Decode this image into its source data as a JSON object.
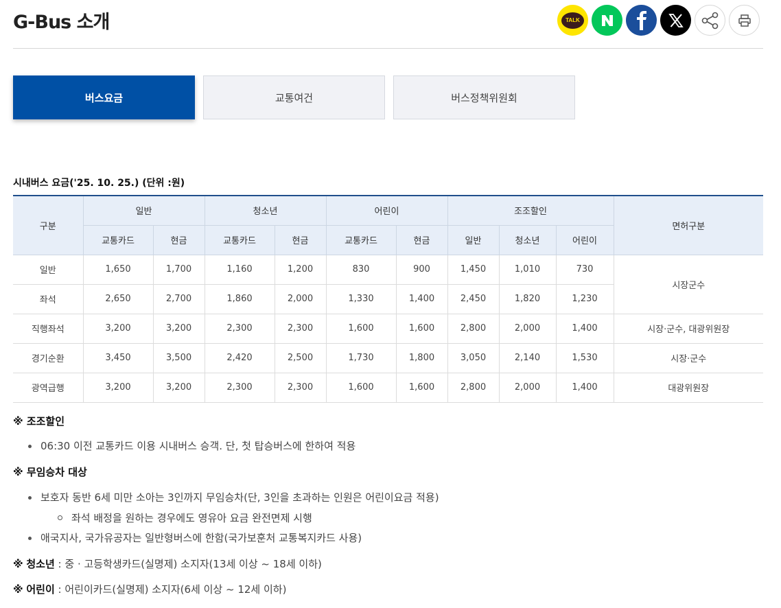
{
  "page": {
    "title": "G-Bus 소개"
  },
  "share": {
    "kakao_label": "TALK",
    "naver_icon": "naver-n-icon",
    "facebook_icon": "facebook-f-icon",
    "x_icon": "x-logo-icon",
    "share_icon": "share-nodes-icon",
    "print_icon": "printer-icon"
  },
  "tabs": [
    {
      "label": "버스요금",
      "active": true
    },
    {
      "label": "교통여건",
      "active": false
    },
    {
      "label": "버스정책위원회",
      "active": false
    }
  ],
  "table": {
    "caption": "시내버스 요금('25. 10. 25.) (단위 :원)",
    "head": {
      "category": "구분",
      "groups": [
        "일반",
        "청소년",
        "어린이",
        "조조할인"
      ],
      "license": "면허구분",
      "sub": [
        "교통카드",
        "현금",
        "교통카드",
        "현금",
        "교통카드",
        "현금",
        "일반",
        "청소년",
        "어린이"
      ]
    },
    "rows": [
      {
        "name": "일반",
        "values": [
          "1,650",
          "1,700",
          "1,160",
          "1,200",
          "830",
          "900",
          "1,450",
          "1,010",
          "730"
        ]
      },
      {
        "name": "좌석",
        "values": [
          "2,650",
          "2,700",
          "1,860",
          "2,000",
          "1,330",
          "1,400",
          "2,450",
          "1,820",
          "1,230"
        ]
      },
      {
        "name": "직행좌석",
        "values": [
          "3,200",
          "3,200",
          "2,300",
          "2,300",
          "1,600",
          "1,600",
          "2,800",
          "2,000",
          "1,400"
        ]
      },
      {
        "name": "경기순환",
        "values": [
          "3,450",
          "3,500",
          "2,420",
          "2,500",
          "1,730",
          "1,800",
          "3,050",
          "2,140",
          "1,530"
        ]
      },
      {
        "name": "광역급행",
        "values": [
          "3,200",
          "3,200",
          "2,300",
          "2,300",
          "1,600",
          "1,600",
          "2,800",
          "2,000",
          "1,400"
        ]
      }
    ],
    "license": [
      "시장군수",
      "시장·군수, 대광위원장",
      "시장·군수",
      "대광위원장"
    ]
  },
  "notes": {
    "mark": "※",
    "early_title": "조조할인",
    "early_item": "06:30 이전 교통카드 이용 시내버스 승객. 단, 첫 탑승버스에 한하여 적용",
    "free_title": "무임승차 대상",
    "free_item1": "보호자 동반 6세 미만 소아는 3인까지 무임승차(단, 3인을 초과하는 인원은 어린이요금 적용)",
    "free_sub1": "좌석 배정을 원하는 경우에도 영유아 요금 완전면제 시행",
    "free_item2": "애국지사, 국가유공자는 일반형버스에 한함(국가보훈처 교통복지카드 사용)",
    "youth_title": "청소년",
    "youth_text": " : 중 · 고등학생카드(실명제) 소지자(13세 이상 ~ 18세 이하)",
    "child_title": "어린이",
    "child_text": " : 어린이카드(실명제) 소지자(6세 이상 ~ 12세 이하)"
  }
}
